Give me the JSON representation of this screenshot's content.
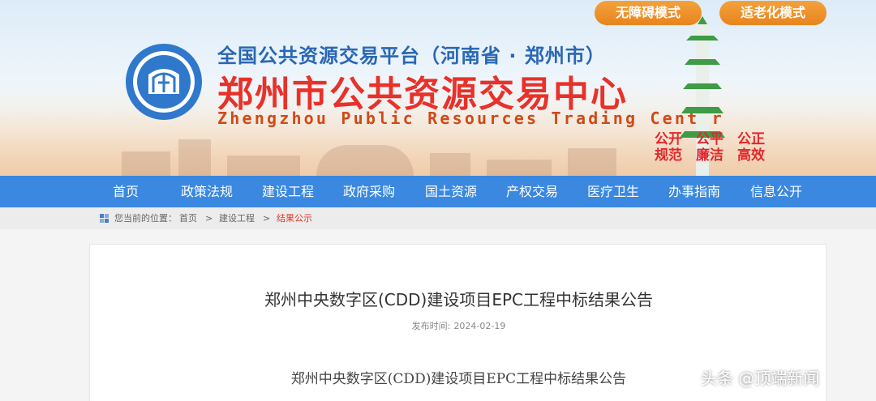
{
  "header": {
    "accessibility_label": "无障碍模式",
    "elderly_label": "适老化模式",
    "subtitle": "全国公共资源交易平台（河南省 · 郑州市）",
    "title": "郑州市公共资源交易中心",
    "title_en": "Zhengzhou Public Resources Trading Center",
    "motto": [
      "公开",
      "规范",
      "公平",
      "廉洁",
      "公正",
      "高效"
    ]
  },
  "nav": {
    "items": [
      "首页",
      "政策法规",
      "建设工程",
      "政府采购",
      "国土资源",
      "产权交易",
      "医疗卫生",
      "办事指南",
      "信息公开"
    ]
  },
  "breadcrumb": {
    "prefix": "您当前的位置：",
    "items": [
      "首页",
      "建设工程",
      "结果公示"
    ],
    "separator": ">"
  },
  "article": {
    "title": "郑州中央数字区(CDD)建设项目EPC工程中标结果公告",
    "publish_label": "发布时间:",
    "publish_date": "2024-02-19",
    "body_heading": "郑州中央数字区(CDD)建设项目EPC工程中标结果公告"
  },
  "watermark": "头条 @顶端新闻",
  "colors": {
    "nav": "#3a88e0",
    "title_red": "#e8312a",
    "subtitle_blue": "#2a67b4",
    "button_orange": "#ef921f"
  }
}
